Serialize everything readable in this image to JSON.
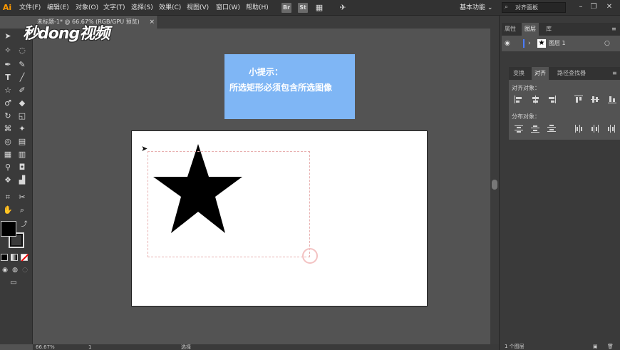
{
  "app": {
    "logo": "Ai"
  },
  "menu": [
    "文件(F)",
    "编辑(E)",
    "对象(O)",
    "文字(T)",
    "选择(S)",
    "效果(C)",
    "视图(V)",
    "窗口(W)",
    "帮助(H)"
  ],
  "toolbar_buttons": {
    "bridge": "Br",
    "stock": "St"
  },
  "workspace": {
    "label": "基本功能 ⌄"
  },
  "search": {
    "placeholder": "对齐面板"
  },
  "doc_tab": {
    "title": "未标题-1* @ 66.67% (RGB/GPU 预览)",
    "close": "×"
  },
  "watermark": {
    "text": "秒dong视频"
  },
  "tip": {
    "title": "小提示：",
    "body": "所选矩形必须包含所选图像"
  },
  "layers_panel": {
    "tabs": [
      "属性",
      "图层",
      "库"
    ],
    "active_tab": "图层",
    "layer_name": "图层 1"
  },
  "align_panel": {
    "tabs": [
      "变换",
      "对齐",
      "路径查找器"
    ],
    "active_tab": "对齐",
    "align_objects_label": "对齐对象：",
    "distribute_objects_label": "分布对象："
  },
  "statusbar": {
    "zoom": "66.67%",
    "page": "1",
    "tool": "选择"
  },
  "layers_footer": {
    "count": "1 个图层"
  },
  "colors": {
    "ai_orange": "#ff9a00",
    "tip_blue": "#7fb6f5",
    "panel_dark": "#3a3a3a",
    "canvas_bg": "#535353"
  }
}
